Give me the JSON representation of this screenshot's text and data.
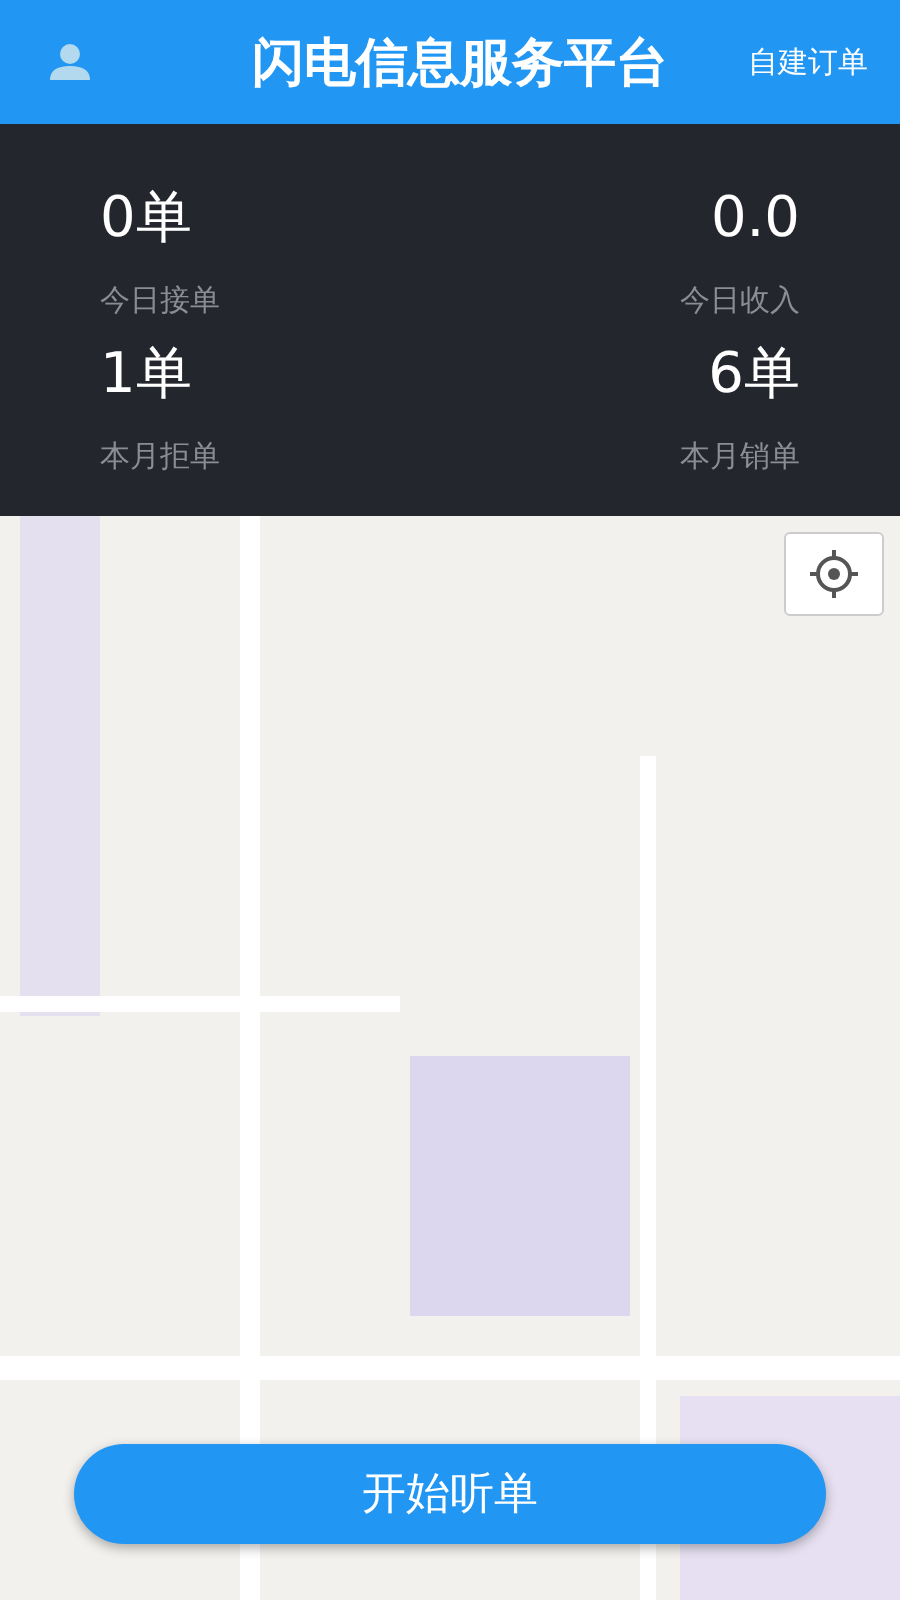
{
  "header": {
    "title": "闪电信息服务平台",
    "action": "自建订单"
  },
  "stats": [
    {
      "value": "0单",
      "label": "今日接单"
    },
    {
      "value": "0.0",
      "label": "今日收入"
    },
    {
      "value": "1单",
      "label": "本月拒单"
    },
    {
      "value": "6单",
      "label": "本月销单"
    }
  ],
  "start_button": {
    "label": "开始听单"
  }
}
